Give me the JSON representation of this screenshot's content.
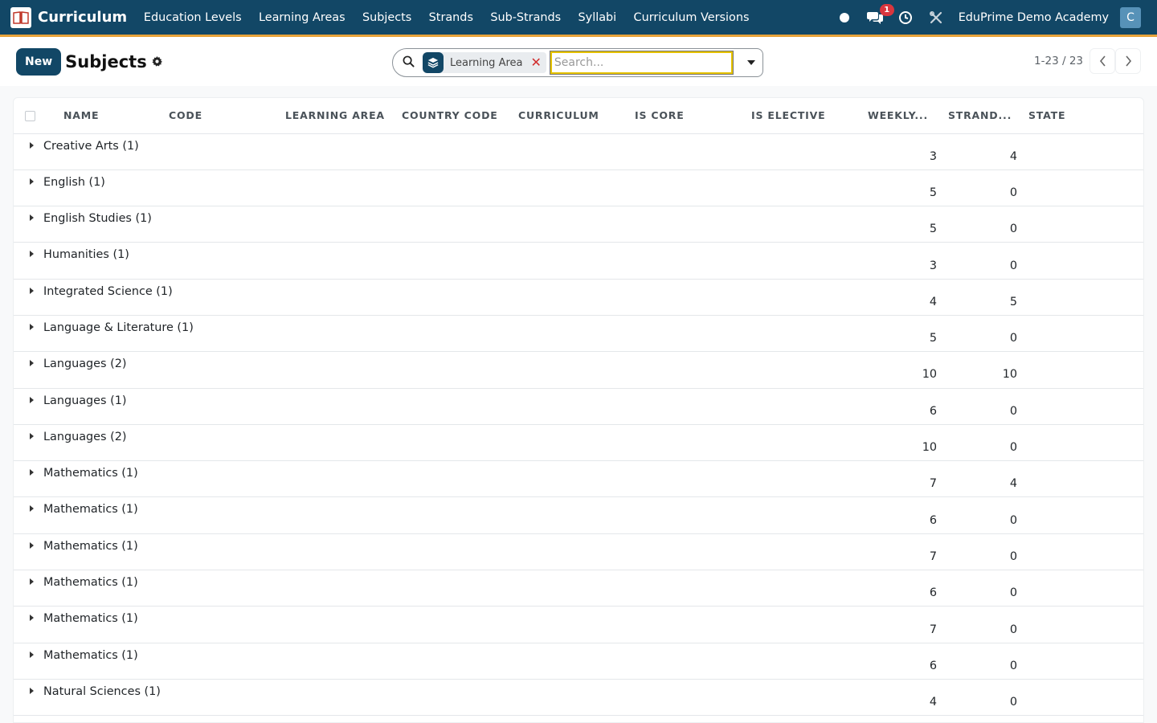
{
  "navbar": {
    "app_title": "Curriculum",
    "menu": [
      "Education Levels",
      "Learning Areas",
      "Subjects",
      "Strands",
      "Sub-Strands",
      "Syllabi",
      "Curriculum Versions"
    ],
    "messages_badge": "1",
    "company": "EduPrime Demo Academy",
    "avatar_letter": "C",
    "colors": {
      "bar": "#124766",
      "accent": "#e8a33a"
    }
  },
  "control_panel": {
    "new_label": "New",
    "title": "Subjects",
    "facet_label": "Learning Area",
    "search_placeholder": "Search...",
    "pager_value": "1-23 / 23"
  },
  "list": {
    "columns": [
      "NAME",
      "CODE",
      "LEARNING AREA",
      "COUNTRY CODE",
      "CURRICULUM",
      "IS CORE",
      "IS ELECTIVE",
      "WEEKLY...",
      "STRAND...",
      "STATE"
    ],
    "groups": [
      {
        "name": "Creative Arts (1)",
        "weekly": "3",
        "strands": "4"
      },
      {
        "name": "English (1)",
        "weekly": "5",
        "strands": "0"
      },
      {
        "name": "English Studies (1)",
        "weekly": "5",
        "strands": "0"
      },
      {
        "name": "Humanities (1)",
        "weekly": "3",
        "strands": "0"
      },
      {
        "name": "Integrated Science (1)",
        "weekly": "4",
        "strands": "5"
      },
      {
        "name": "Language & Literature (1)",
        "weekly": "5",
        "strands": "0"
      },
      {
        "name": "Languages (2)",
        "weekly": "10",
        "strands": "10"
      },
      {
        "name": "Languages (1)",
        "weekly": "6",
        "strands": "0"
      },
      {
        "name": "Languages (2)",
        "weekly": "10",
        "strands": "0"
      },
      {
        "name": "Mathematics (1)",
        "weekly": "7",
        "strands": "4"
      },
      {
        "name": "Mathematics (1)",
        "weekly": "6",
        "strands": "0"
      },
      {
        "name": "Mathematics (1)",
        "weekly": "7",
        "strands": "0"
      },
      {
        "name": "Mathematics (1)",
        "weekly": "6",
        "strands": "0"
      },
      {
        "name": "Mathematics (1)",
        "weekly": "7",
        "strands": "0"
      },
      {
        "name": "Mathematics (1)",
        "weekly": "6",
        "strands": "0"
      },
      {
        "name": "Natural Sciences (1)",
        "weekly": "4",
        "strands": "0"
      }
    ]
  }
}
